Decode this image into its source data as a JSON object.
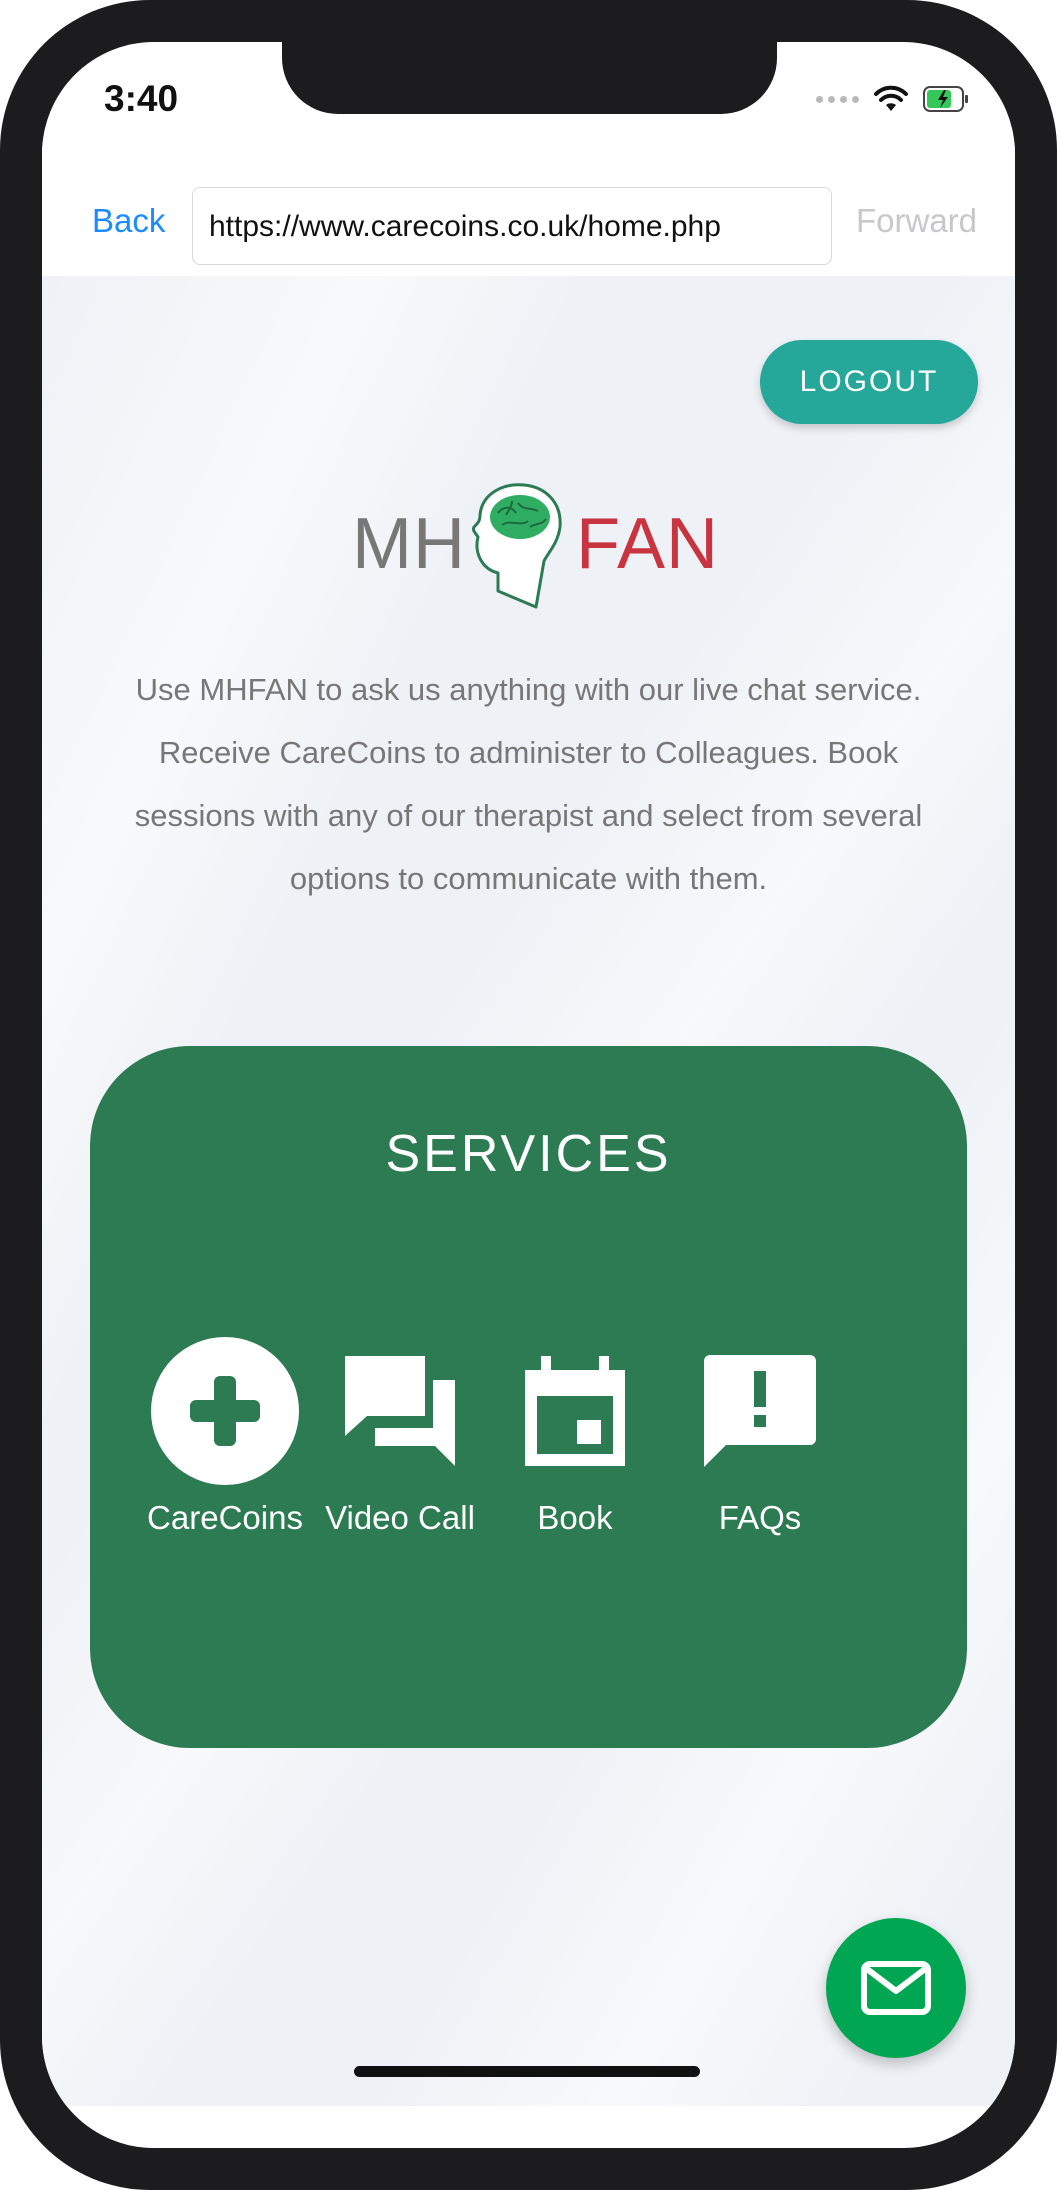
{
  "status_bar": {
    "time": "3:40"
  },
  "browser": {
    "back_label": "Back",
    "url": "https://www.carecoins.co.uk/home.php",
    "forward_label": "Forward"
  },
  "header": {
    "logout_label": "LOGOUT"
  },
  "logo": {
    "left_text": "MH",
    "right_text": "FAN"
  },
  "intro": {
    "text": "Use MHFAN to ask us anything with our live chat service. Receive CareCoins to administer to Colleagues. Book sessions with any of our therapist and select from several options to communicate with them."
  },
  "services": {
    "title": "SERVICES",
    "items": [
      {
        "label": "CareCoins",
        "icon": "plus-circle-icon"
      },
      {
        "label": "Video Call",
        "icon": "chat-bubbles-icon"
      },
      {
        "label": "Book",
        "icon": "calendar-icon"
      },
      {
        "label": "FAQs",
        "icon": "alert-message-icon"
      }
    ]
  },
  "colors": {
    "accent_teal": "#25a79a",
    "services_green": "#2d7b52",
    "fab_green": "#00a652",
    "logo_red": "#c8343f",
    "link_blue": "#1a8cff"
  }
}
